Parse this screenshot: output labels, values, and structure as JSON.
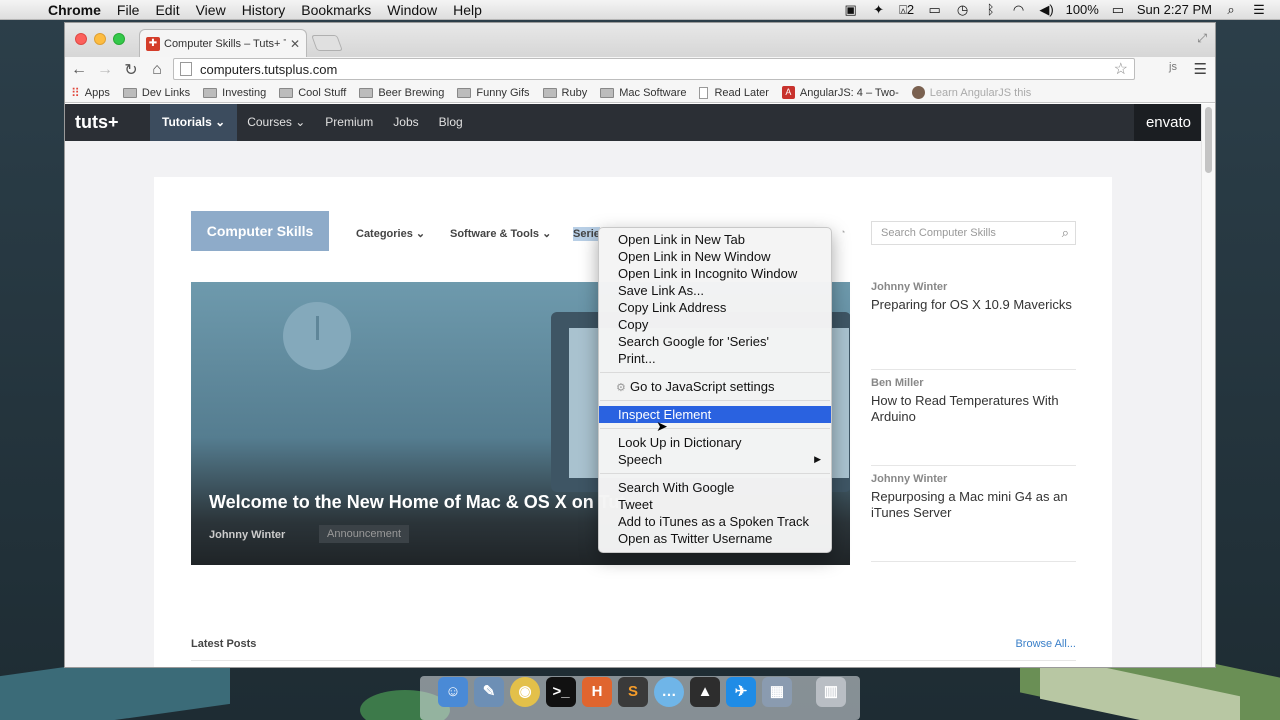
{
  "menubar": {
    "app": "Chrome",
    "items": [
      "File",
      "Edit",
      "View",
      "History",
      "Bookmarks",
      "Window",
      "Help"
    ],
    "status": {
      "notif_count": "2",
      "battery": "100%",
      "clock": "Sun 2:27 PM"
    }
  },
  "browser": {
    "tab_title": "Computer Skills – Tuts+ T",
    "url": "computers.tutsplus.com",
    "bookmarks": [
      "Apps",
      "Dev Links",
      "Investing",
      "Cool Stuff",
      "Beer Brewing",
      "Funny Gifs",
      "Ruby",
      "Mac Software",
      "Read Later",
      "AngularJS: 4 – Two-",
      "Learn AngularJS this"
    ]
  },
  "site": {
    "logo": "tuts+",
    "nav": [
      "Tutorials",
      "Courses",
      "Premium",
      "Jobs",
      "Blog"
    ],
    "brand": "envato",
    "section_badge": "Computer Skills",
    "subnav": [
      "Categories",
      "Software & Tools",
      "Serie"
    ],
    "subnav_caret": "⌄",
    "search_placeholder": "Search Computer Skills",
    "hero": {
      "title": "Welcome to the New Home of Mac & OS X on Tut",
      "author": "Johnny Winter",
      "tag": "Announcement"
    },
    "sidebar_posts": [
      {
        "author": "Johnny Winter",
        "title": "Preparing for OS X 10.9 Mavericks"
      },
      {
        "author": "Ben Miller",
        "title": "How to Read Temperatures With Arduino"
      },
      {
        "author": "Johnny Winter",
        "title": "Repurposing a Mac mini G4 as an iTunes Server"
      }
    ],
    "latest_label": "Latest Posts",
    "browse_all": "Browse All..."
  },
  "context_menu": {
    "groups": [
      [
        "Open Link in New Tab",
        "Open Link in New Window",
        "Open Link in Incognito Window",
        "Save Link As...",
        "Copy Link Address",
        "Copy",
        "Search Google for 'Series'",
        "Print..."
      ],
      [
        "Go to JavaScript settings"
      ],
      [
        "Inspect Element"
      ],
      [
        "Look Up in Dictionary",
        "Speech"
      ],
      [
        "Search With Google",
        "Tweet",
        "Add to iTunes as a Spoken Track",
        "Open as Twitter Username"
      ]
    ],
    "selected": "Inspect Element"
  },
  "dock": [
    "Finder",
    "Preview",
    "Chrome",
    "Terminal",
    "H",
    "Sublime",
    "Messages",
    "Rocket",
    "Twitter",
    "Photos",
    "Trash"
  ]
}
